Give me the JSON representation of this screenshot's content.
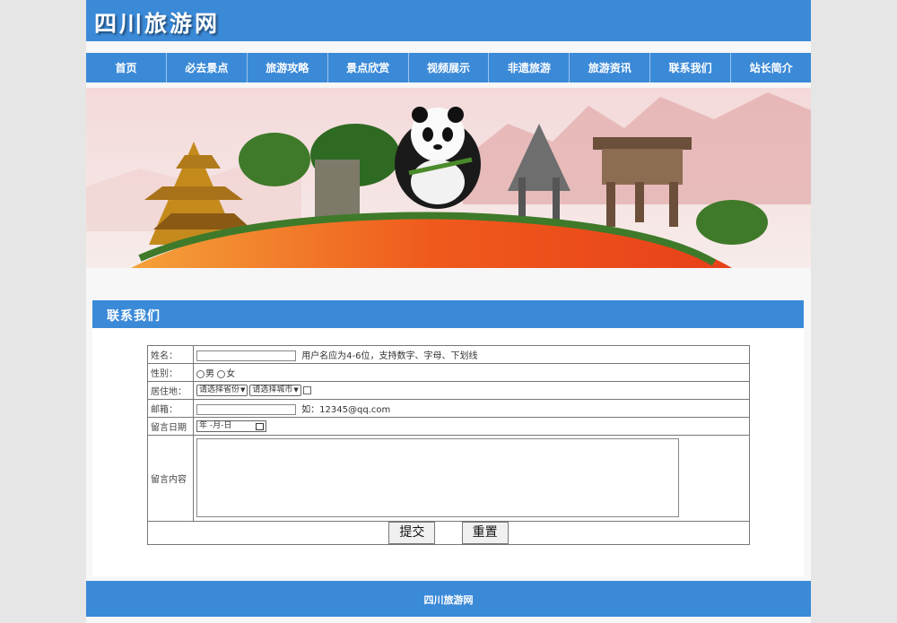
{
  "site": {
    "title": "四川旅游网"
  },
  "nav": {
    "items": [
      "首页",
      "必去景点",
      "旅游攻略",
      "景点欣赏",
      "视频展示",
      "非遗旅游",
      "旅游资讯",
      "联系我们",
      "站长简介"
    ]
  },
  "section": {
    "title": "联系我们"
  },
  "form": {
    "name": {
      "label": "姓名：",
      "value": "",
      "hint": "用户名应为4-6位，支持数字、字母、下划线"
    },
    "gender": {
      "label": "性别：",
      "options": [
        "男",
        "女"
      ]
    },
    "residence": {
      "label": "居住地：",
      "province_placeholder": "请选择省份",
      "city_placeholder": "请选择城市"
    },
    "email": {
      "label": "邮箱：",
      "value": "",
      "hint": "如：12345@qq.com"
    },
    "date": {
      "label": "留言日期",
      "placeholder": "年 -月-日"
    },
    "message": {
      "label": "留言内容",
      "value": ""
    },
    "submit_label": "提交",
    "reset_label": "重置"
  },
  "footer": {
    "text": "四川旅游网"
  },
  "colors": {
    "brand": "#3b8ad8",
    "nav_divider": "#9cc3ec"
  }
}
